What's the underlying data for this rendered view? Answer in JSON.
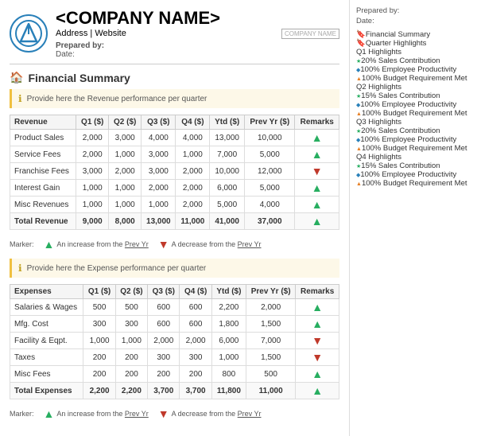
{
  "header": {
    "company_name": "<COMPANY NAME>",
    "address": "Address | Website",
    "company_label": "COMPANY NAME",
    "prepared_by_label": "Prepared by:",
    "date_label": "Date:"
  },
  "sidebar": {
    "prepared_by_label": "Prepared by:",
    "date_label": "Date:",
    "nav": [
      {
        "type": "section",
        "label": "Financial Summary",
        "color": "blue"
      },
      {
        "type": "section",
        "label": "Quarter Highlights",
        "color": "red"
      },
      {
        "type": "subsection",
        "label": "Q1 Highlights"
      },
      {
        "type": "item",
        "icon": "green",
        "label": "20% Sales Contribution"
      },
      {
        "type": "item",
        "icon": "blue",
        "label": "100% Employee Productivity"
      },
      {
        "type": "item",
        "icon": "orange",
        "label": "100% Budget Requirement Met"
      },
      {
        "type": "subsection",
        "label": "Q2 Highlights"
      },
      {
        "type": "item",
        "icon": "green",
        "label": "15% Sales Contribution"
      },
      {
        "type": "item",
        "icon": "blue",
        "label": "100% Employee Productivity"
      },
      {
        "type": "item",
        "icon": "orange",
        "label": "100% Budget Requirement Met"
      },
      {
        "type": "subsection",
        "label": "Q3 Highlights"
      },
      {
        "type": "item",
        "icon": "green",
        "label": "20% Sales Contribution"
      },
      {
        "type": "item",
        "icon": "blue",
        "label": "100% Employee Productivity"
      },
      {
        "type": "item",
        "icon": "orange",
        "label": "100% Budget Requirement Met"
      },
      {
        "type": "subsection",
        "label": "Q4 Highlights"
      },
      {
        "type": "item",
        "icon": "green",
        "label": "15% Sales Contribution"
      },
      {
        "type": "item",
        "icon": "blue",
        "label": "100% Employee Productivity"
      },
      {
        "type": "item",
        "icon": "orange",
        "label": "100% Budget Requirement Met"
      }
    ]
  },
  "financial_summary": {
    "title": "Financial Summary",
    "revenue_info": "Provide here the Revenue performance per quarter",
    "expense_info": "Provide here the Expense performance per quarter",
    "revenue_table": {
      "headers": [
        "Revenue",
        "Q1 ($)",
        "Q2 ($)",
        "Q3 ($)",
        "Q4 ($)",
        "Ytd ($)",
        "Prev Yr ($)",
        "Remarks"
      ],
      "rows": [
        {
          "label": "Product Sales",
          "q1": "2,000",
          "q2": "3,000",
          "q3": "4,000",
          "q4": "4,000",
          "ytd": "13,000",
          "prev": "10,000",
          "dir": "up"
        },
        {
          "label": "Service Fees",
          "q1": "2,000",
          "q2": "1,000",
          "q3": "3,000",
          "q4": "1,000",
          "ytd": "7,000",
          "prev": "5,000",
          "dir": "up"
        },
        {
          "label": "Franchise Fees",
          "q1": "3,000",
          "q2": "2,000",
          "q3": "3,000",
          "q4": "2,000",
          "ytd": "10,000",
          "prev": "12,000",
          "dir": "down"
        },
        {
          "label": "Interest Gain",
          "q1": "1,000",
          "q2": "1,000",
          "q3": "2,000",
          "q4": "2,000",
          "ytd": "6,000",
          "prev": "5,000",
          "dir": "up"
        },
        {
          "label": "Misc Revenues",
          "q1": "1,000",
          "q2": "1,000",
          "q3": "1,000",
          "q4": "2,000",
          "ytd": "5,000",
          "prev": "4,000",
          "dir": "up"
        },
        {
          "label": "Total Revenue",
          "q1": "9,000",
          "q2": "8,000",
          "q3": "13,000",
          "q4": "11,000",
          "ytd": "41,000",
          "prev": "37,000",
          "dir": "up",
          "total": true
        }
      ]
    },
    "expense_table": {
      "headers": [
        "Expenses",
        "Q1 ($)",
        "Q2 ($)",
        "Q3 ($)",
        "Q4 ($)",
        "Ytd ($)",
        "Prev Yr ($)",
        "Remarks"
      ],
      "rows": [
        {
          "label": "Salaries & Wages",
          "q1": "500",
          "q2": "500",
          "q3": "600",
          "q4": "600",
          "ytd": "2,200",
          "prev": "2,000",
          "dir": "up"
        },
        {
          "label": "Mfg. Cost",
          "q1": "300",
          "q2": "300",
          "q3": "600",
          "q4": "600",
          "ytd": "1,800",
          "prev": "1,500",
          "dir": "up"
        },
        {
          "label": "Facility & Eqpt.",
          "q1": "1,000",
          "q2": "1,000",
          "q3": "2,000",
          "q4": "2,000",
          "ytd": "6,000",
          "prev": "7,000",
          "dir": "down"
        },
        {
          "label": "Taxes",
          "q1": "200",
          "q2": "200",
          "q3": "300",
          "q4": "300",
          "ytd": "1,000",
          "prev": "1,500",
          "dir": "down"
        },
        {
          "label": "Misc Fees",
          "q1": "200",
          "q2": "200",
          "q3": "200",
          "q4": "200",
          "ytd": "800",
          "prev": "500",
          "dir": "up"
        },
        {
          "label": "Total Expenses",
          "q1": "2,200",
          "q2": "2,200",
          "q3": "3,700",
          "q4": "3,700",
          "ytd": "11,800",
          "prev": "11,000",
          "dir": "up",
          "total": true
        }
      ]
    },
    "marker": {
      "label": "Marker:",
      "up_label": "An increase from the",
      "up_link": "Prev Yr",
      "down_label": "A decrease from the",
      "down_link": "Prev Yr"
    }
  }
}
